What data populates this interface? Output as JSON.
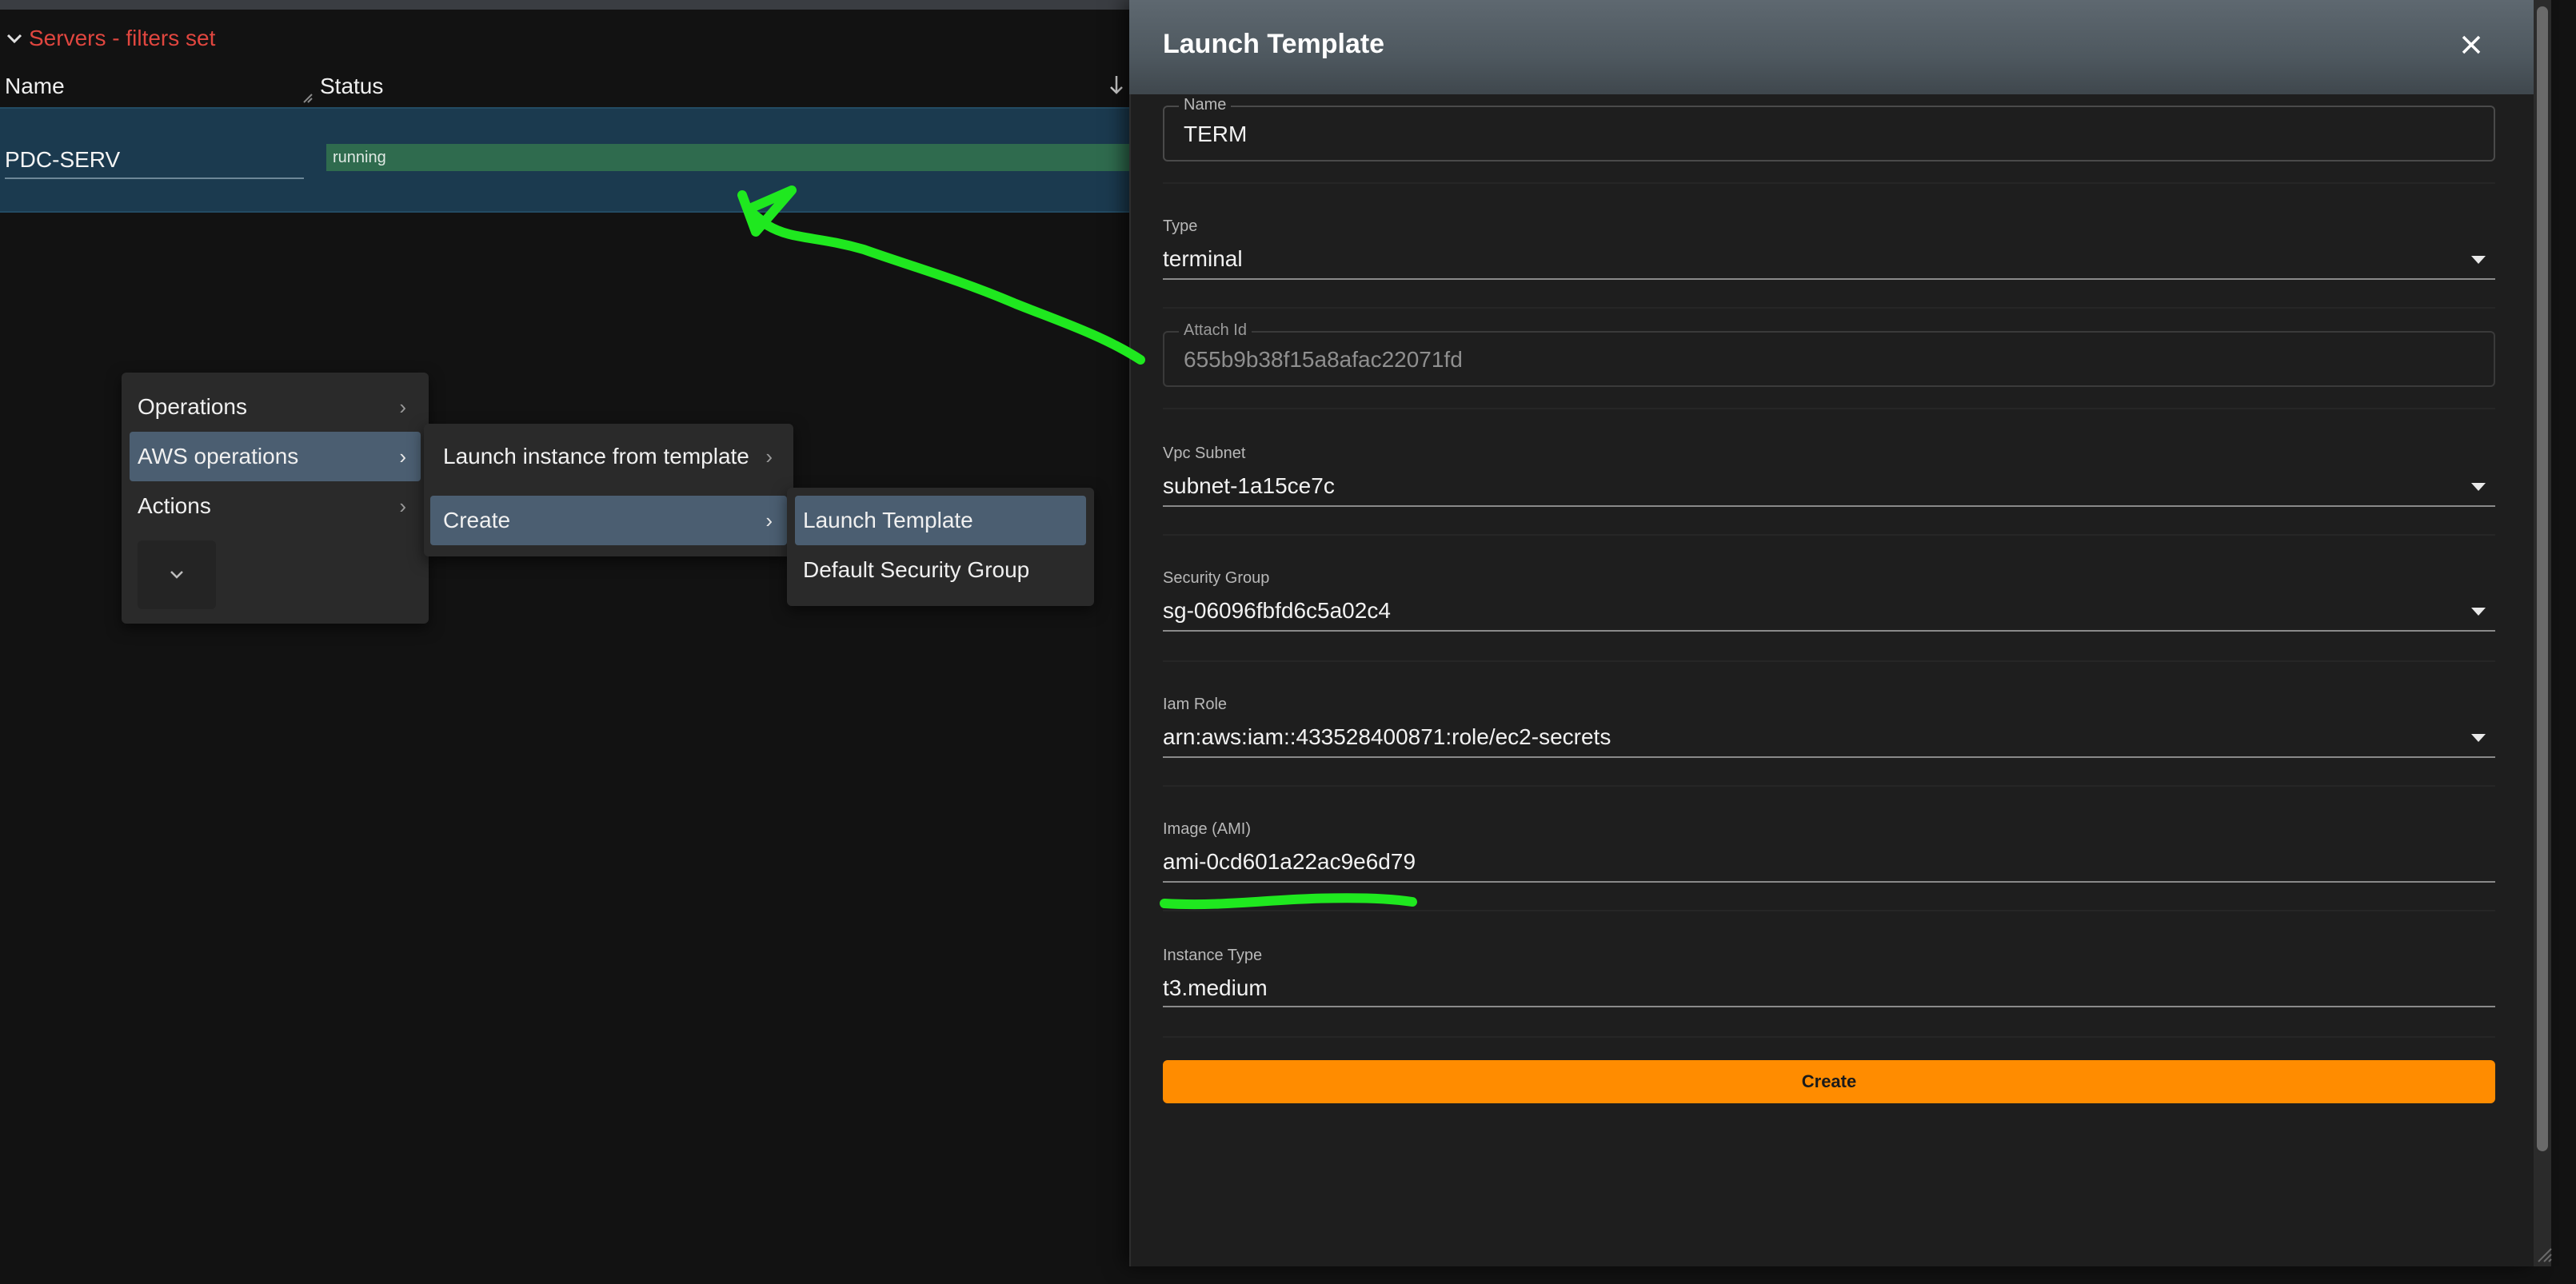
{
  "grid": {
    "title": "Servers - filters set",
    "col_name": "Name",
    "col_status": "Status",
    "row": {
      "name": "PDC-SERV",
      "status": "running"
    }
  },
  "context_menu": {
    "level1": [
      "Operations",
      "AWS operations",
      "Actions"
    ],
    "level2": [
      "Launch instance from template",
      "Create"
    ],
    "level3": [
      "Launch Template",
      "Default Security Group"
    ]
  },
  "dialog": {
    "title": "Launch Template",
    "fields": {
      "name": {
        "label": "Name",
        "value": "TERM"
      },
      "type": {
        "label": "Type",
        "value": "terminal"
      },
      "attach": {
        "label": "Attach Id",
        "value": "655b9b38f15a8afac22071fd"
      },
      "vpc": {
        "label": "Vpc Subnet",
        "value": "subnet-1a15ce7c"
      },
      "sg": {
        "label": "Security Group",
        "value": "sg-06096fbfd6c5a02c4"
      },
      "iam": {
        "label": "Iam Role",
        "value": "arn:aws:iam::433528400871:role/ec2-secrets"
      },
      "ami": {
        "label": "Image (AMI)",
        "value": "ami-0cd601a22ac9e6d79"
      },
      "instance": {
        "label": "Instance Type",
        "value": "t3.medium"
      }
    },
    "create_label": "Create"
  },
  "colors": {
    "accent_orange": "#ff8c00",
    "grid_title_red": "#e0463f",
    "selected_row": "#1b3a4f",
    "status_green": "#2f6b4e",
    "menu_selected": "#4b5e71",
    "annotation_green": "#1fe81f"
  },
  "icons": [
    "chevron-down-icon",
    "sort-down-icon",
    "chevron-right-icon",
    "close-icon",
    "dropdown-arrow-icon"
  ]
}
